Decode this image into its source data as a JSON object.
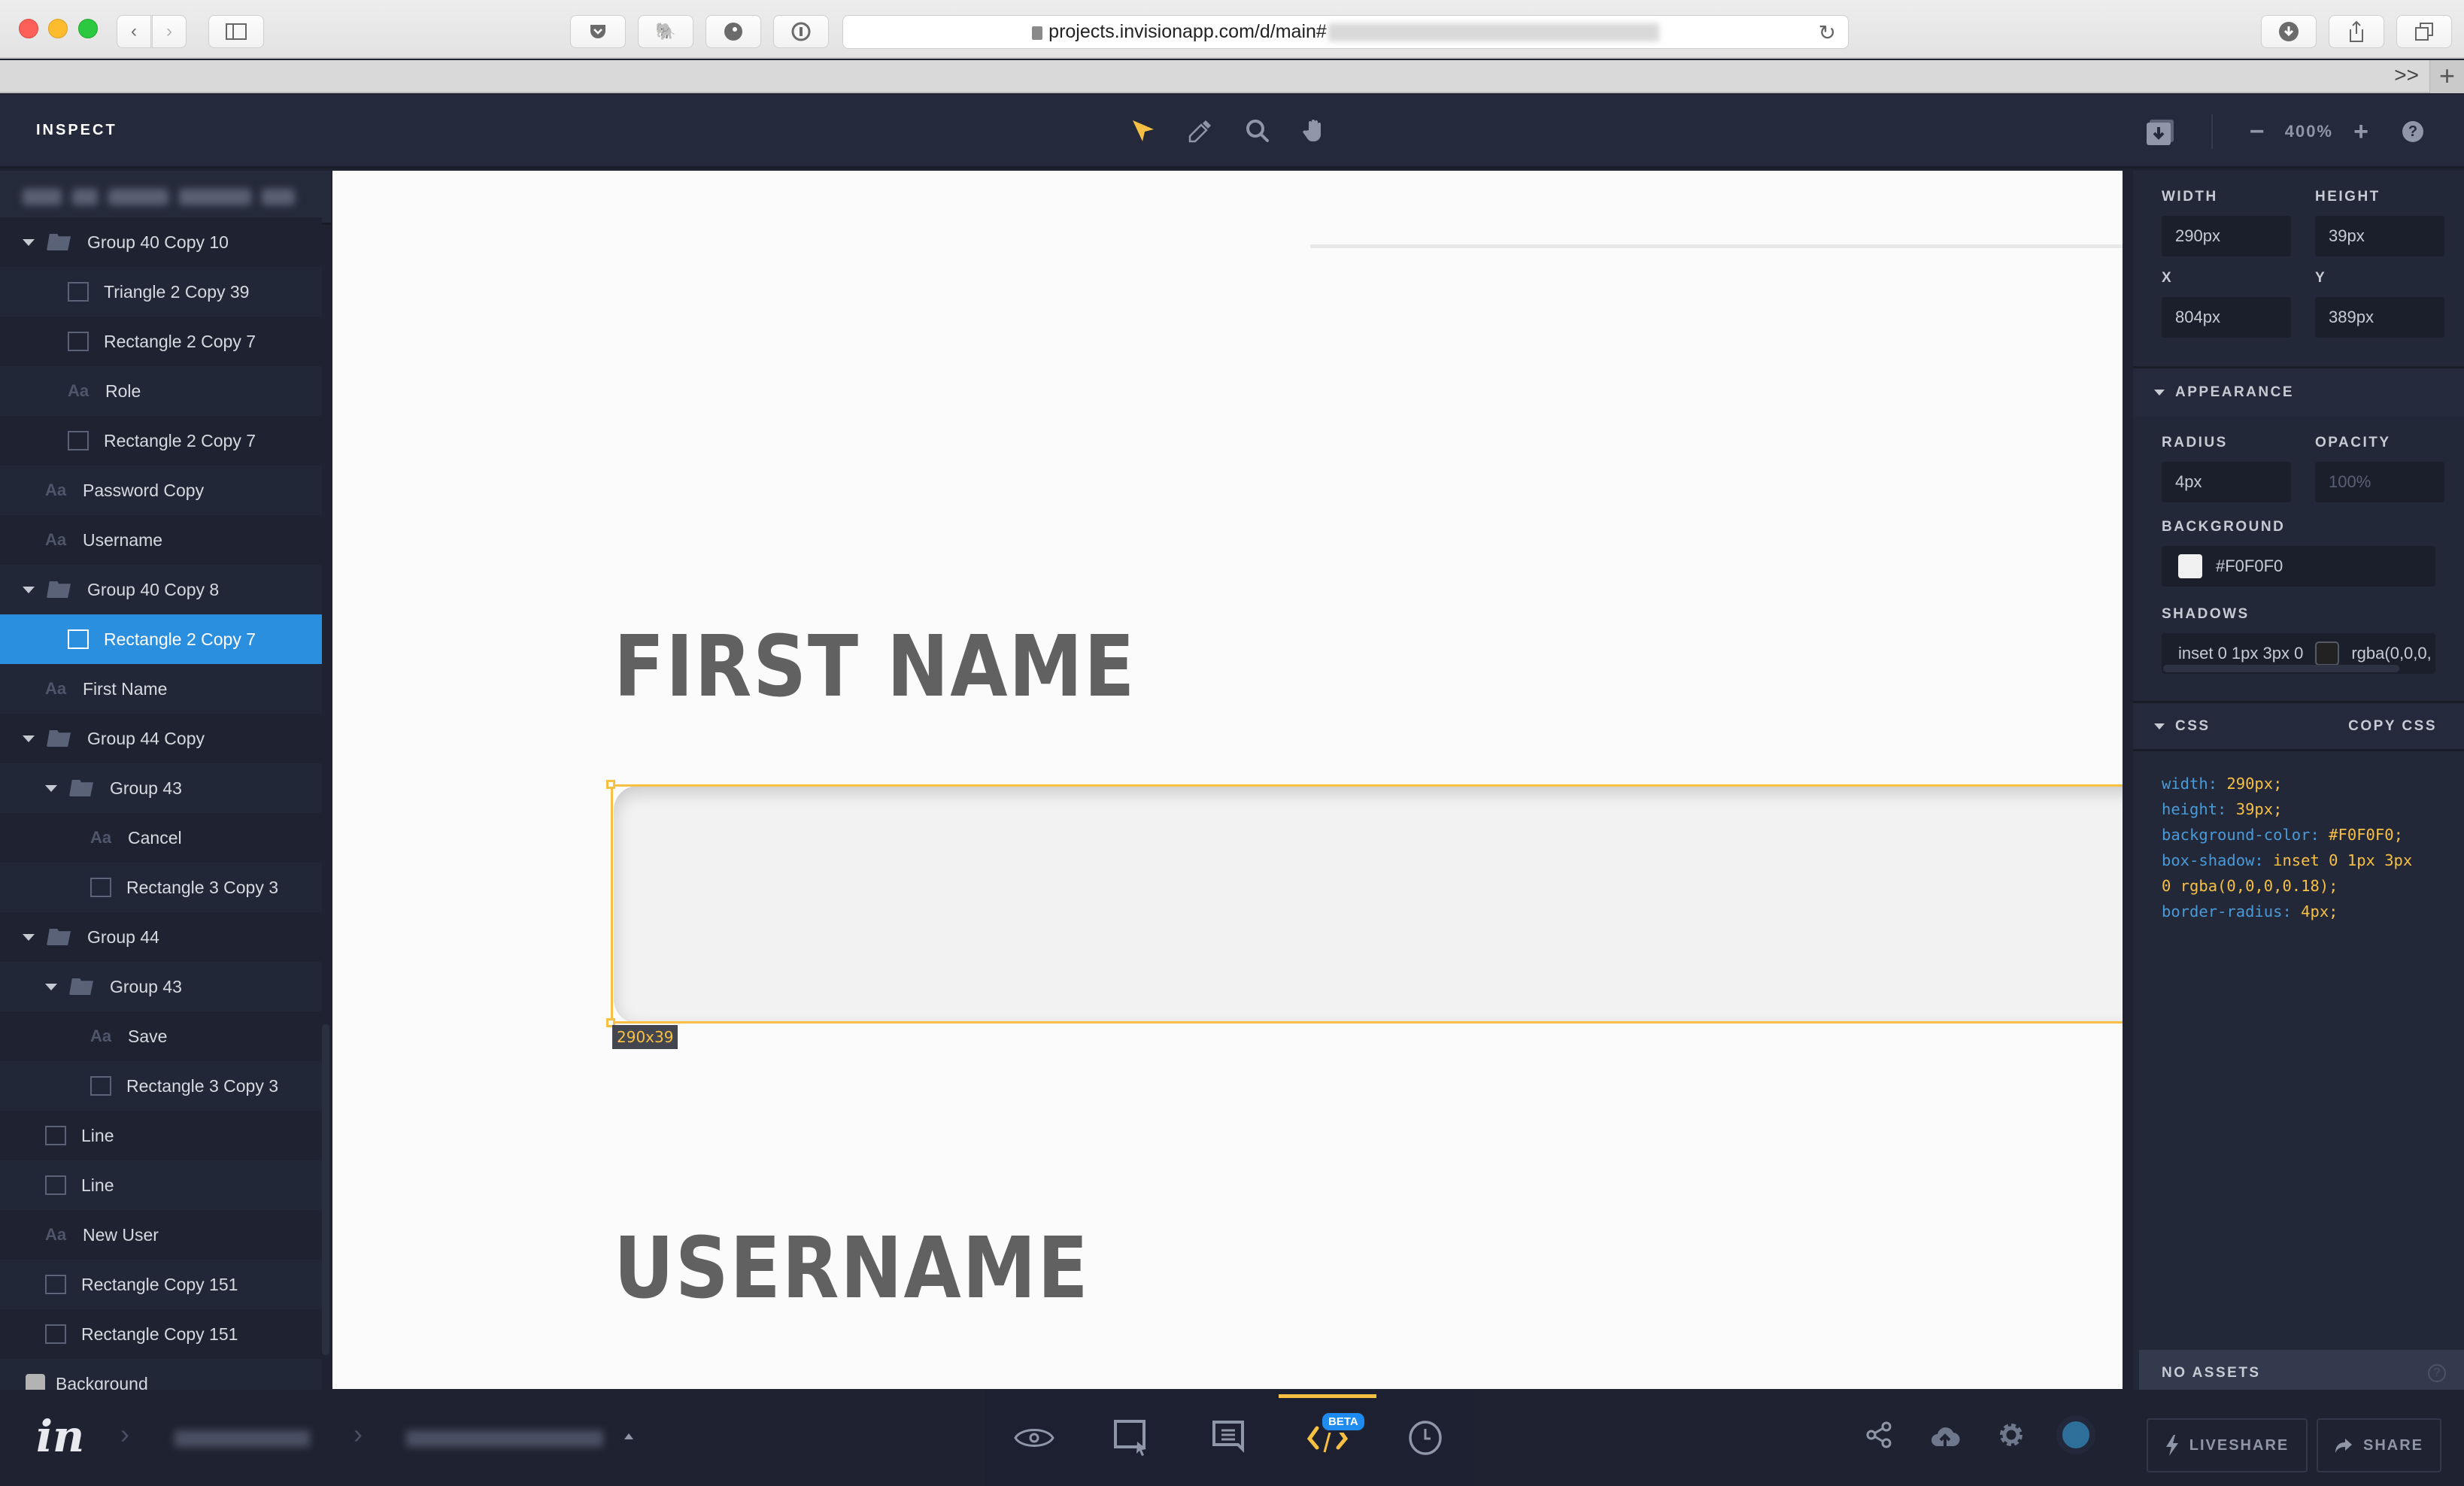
{
  "browser": {
    "url_visible": "projects.invisionapp.com/d/main#",
    "url_rest_blurred": true,
    "tab_overflow_label": ">>",
    "new_tab_label": "+"
  },
  "app": {
    "title": "INSPECT",
    "tools": [
      {
        "name": "select",
        "icon": "cursor-arrow-icon",
        "active": true
      },
      {
        "name": "eyedropper",
        "icon": "eyedropper-icon",
        "active": false
      },
      {
        "name": "zoom",
        "icon": "magnifier-icon",
        "active": false
      },
      {
        "name": "pan",
        "icon": "hand-icon",
        "active": false
      }
    ],
    "zoom": {
      "minus": "−",
      "level": "400%",
      "plus": "+"
    },
    "help": "?"
  },
  "sidebar": {
    "header_blurred": true,
    "layers": [
      {
        "label": "Group 40 Copy 10",
        "type": "group",
        "depth": 0,
        "expanded": true
      },
      {
        "label": "Triangle 2 Copy 39",
        "type": "shape",
        "depth": 1
      },
      {
        "label": "Rectangle 2 Copy 7",
        "type": "shape",
        "depth": 1
      },
      {
        "label": "Role",
        "type": "text",
        "depth": 1
      },
      {
        "label": "Rectangle 2 Copy 7",
        "type": "shape",
        "depth": 1
      },
      {
        "label": "Password Copy",
        "type": "text",
        "depth": 0
      },
      {
        "label": "Username",
        "type": "text",
        "depth": 0
      },
      {
        "label": "Group 40 Copy 8",
        "type": "group",
        "depth": 0,
        "expanded": true
      },
      {
        "label": "Rectangle 2 Copy 7",
        "type": "shape",
        "depth": 1,
        "selected": true
      },
      {
        "label": "First Name",
        "type": "text",
        "depth": 0
      },
      {
        "label": "Group 44 Copy",
        "type": "group",
        "depth": 0,
        "expanded": true
      },
      {
        "label": "Group 43",
        "type": "group",
        "depth": 1,
        "expanded": true
      },
      {
        "label": "Cancel",
        "type": "text",
        "depth": 2
      },
      {
        "label": "Rectangle 3 Copy 3",
        "type": "shape",
        "depth": 2
      },
      {
        "label": "Group 44",
        "type": "group",
        "depth": 0,
        "expanded": true
      },
      {
        "label": "Group 43",
        "type": "group",
        "depth": 1,
        "expanded": true
      },
      {
        "label": "Save",
        "type": "text",
        "depth": 2
      },
      {
        "label": "Rectangle 3 Copy 3",
        "type": "shape",
        "depth": 2
      },
      {
        "label": "Line",
        "type": "shape",
        "depth": 0
      },
      {
        "label": "Line",
        "type": "shape",
        "depth": 0
      },
      {
        "label": "New User",
        "type": "text",
        "depth": 0
      },
      {
        "label": "Rectangle Copy 151",
        "type": "shape",
        "depth": 0
      },
      {
        "label": "Rectangle Copy 151",
        "type": "shape",
        "depth": 0
      },
      {
        "label": "Background",
        "type": "background",
        "depth": -1
      }
    ]
  },
  "canvas": {
    "labels": {
      "first_name": "FIRST NAME",
      "username": "USERNAME"
    },
    "selection_badge": "290x39",
    "selection_color": "#F7C043"
  },
  "inspector": {
    "width": {
      "label": "WIDTH",
      "value": "290px"
    },
    "height": {
      "label": "HEIGHT",
      "value": "39px"
    },
    "x": {
      "label": "X",
      "value": "804px"
    },
    "y": {
      "label": "Y",
      "value": "389px"
    },
    "appearance": {
      "title": "APPEARANCE",
      "radius": {
        "label": "RADIUS",
        "value": "4px"
      },
      "opacity": {
        "label": "OPACITY",
        "placeholder": "100%"
      },
      "background": {
        "label": "BACKGROUND",
        "value": "#F0F0F0",
        "swatch": "#F0F0F0"
      },
      "shadows": {
        "label": "SHADOWS",
        "value_left": "inset 0 1px 3px 0",
        "value_right": "rgba(0,0,0,"
      }
    },
    "css": {
      "title": "CSS",
      "copy_label": "COPY CSS",
      "lines": [
        {
          "prop": "width:",
          "val": "290px;"
        },
        {
          "prop": "height:",
          "val": "39px;"
        },
        {
          "prop": "background-color:",
          "val": "#F0F0F0;"
        },
        {
          "prop": "box-shadow:",
          "val": "inset 0 1px 3px"
        },
        {
          "prop": "",
          "val": "0 rgba(0,0,0,0.18);"
        },
        {
          "prop": "border-radius:",
          "val": "4px;"
        }
      ]
    },
    "assets_label": "NO ASSETS",
    "assets_help": "?"
  },
  "bottombar": {
    "logo": "in",
    "breadcrumbs_blurred": true,
    "modes": [
      {
        "name": "preview",
        "icon": "eye-icon"
      },
      {
        "name": "build",
        "icon": "select-box-icon"
      },
      {
        "name": "comment",
        "icon": "comment-icon"
      },
      {
        "name": "inspect",
        "icon": "code-icon",
        "active": true,
        "badge": "BETA"
      },
      {
        "name": "history",
        "icon": "clock-icon"
      }
    ],
    "liveshare_label": "LIVESHARE",
    "share_label": "SHARE",
    "accent_color": "#F7C043"
  }
}
